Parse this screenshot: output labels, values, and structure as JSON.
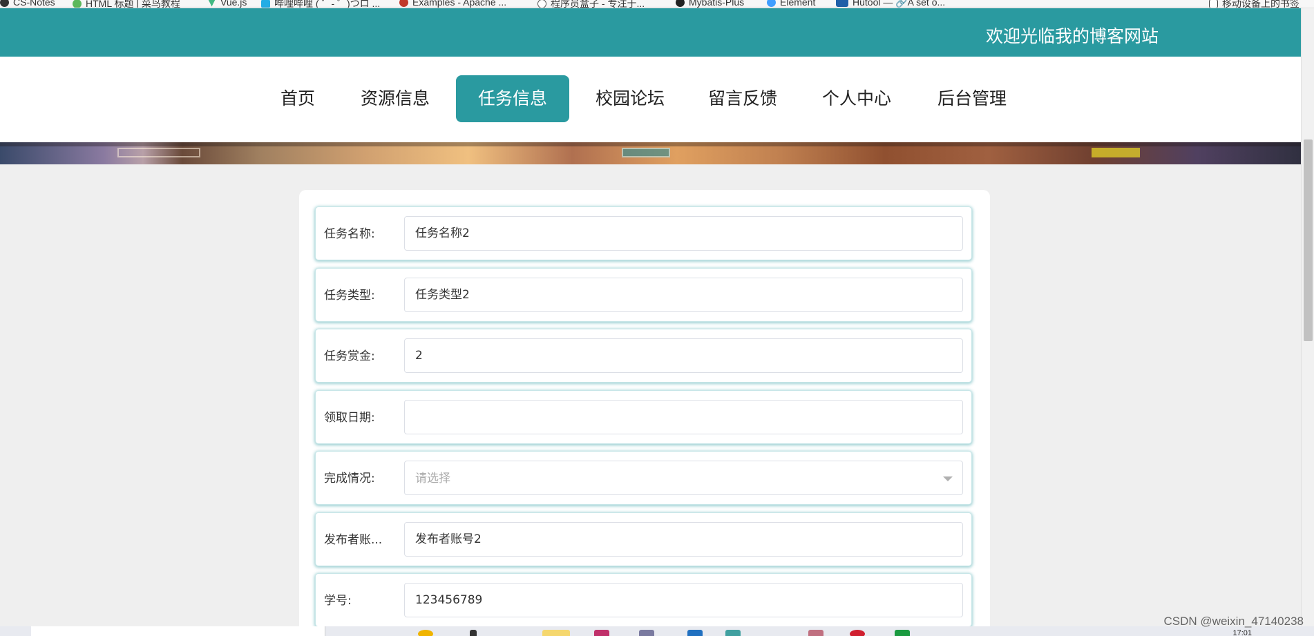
{
  "bookmarks": [
    {
      "label": "CS-Notes",
      "icon": "github-icon",
      "color": "#333333"
    },
    {
      "label": "HTML 标题 | 菜鸟教程",
      "icon": "runoob-icon",
      "color": "#5cb85c"
    },
    {
      "label": "Vue.js",
      "icon": "vue-icon",
      "color": "#41b883"
    },
    {
      "label": "哔哩哔哩 ( ゜- ゜)つロ ...",
      "icon": "bilibili-icon",
      "color": "#23ade5"
    },
    {
      "label": "Examples - Apache ...",
      "icon": "apache-icon",
      "color": "#c0392b"
    },
    {
      "label": "程序员盒子 - 专注于...",
      "icon": "globe-icon",
      "color": "#555555"
    },
    {
      "label": "Mybatis-Plus",
      "icon": "mybatis-icon",
      "color": "#222222"
    },
    {
      "label": "Element",
      "icon": "element-icon",
      "color": "#409eff"
    },
    {
      "label": "Hutool — 🔗A set o...",
      "icon": "hutool-icon",
      "color": "#1f5fa8"
    },
    {
      "label": "移动设备上的书签",
      "icon": "mobile-bookmarks-icon",
      "color": "#444444"
    }
  ],
  "header": {
    "welcome": "欢迎光临我的博客网站",
    "accent": "#2a9aa0"
  },
  "nav": {
    "items": [
      {
        "label": "首页",
        "active": false
      },
      {
        "label": "资源信息",
        "active": false
      },
      {
        "label": "任务信息",
        "active": true
      },
      {
        "label": "校园论坛",
        "active": false
      },
      {
        "label": "留言反馈",
        "active": false
      },
      {
        "label": "个人中心",
        "active": false
      },
      {
        "label": "后台管理",
        "active": false
      }
    ]
  },
  "form": {
    "fields": [
      {
        "label": "任务名称:",
        "value": "任务名称2",
        "type": "text"
      },
      {
        "label": "任务类型:",
        "value": "任务类型2",
        "type": "text"
      },
      {
        "label": "任务赏金:",
        "value": "2",
        "type": "text"
      },
      {
        "label": "领取日期:",
        "value": "",
        "type": "text"
      },
      {
        "label": "完成情况:",
        "value": "",
        "type": "select",
        "placeholder": "请选择"
      },
      {
        "label": "发布者账...",
        "value": "发布者账号2",
        "type": "text"
      },
      {
        "label": "学号:",
        "value": "123456789",
        "type": "text"
      }
    ]
  },
  "taskbar": {
    "time": "17:01"
  },
  "watermark": "CSDN @weixin_47140238"
}
